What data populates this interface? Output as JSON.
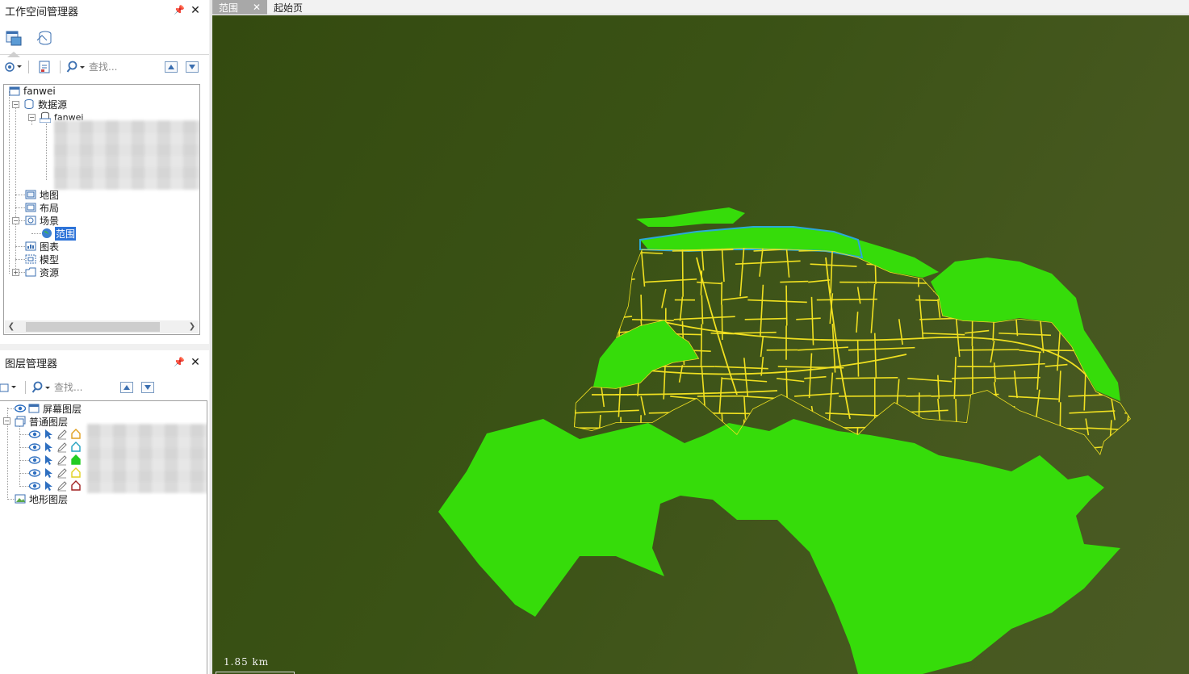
{
  "workspace_panel": {
    "title": "工作空间管理器",
    "search_placeholder": "查找...",
    "tree": {
      "root": "fanwei",
      "datasources": "数据源",
      "datasource_item": "fanwei",
      "maps": "地图",
      "layouts": "布局",
      "scenes": "场景",
      "scene_item": "范围",
      "charts": "图表",
      "models": "模型",
      "resources": "资源"
    }
  },
  "layer_panel": {
    "title": "图层管理器",
    "search_placeholder": "查找...",
    "screen_layers": "屏幕图层",
    "normal_layers": "普通图层",
    "terrain_layers": "地形图层",
    "layer_style_colors": [
      "#e0a020",
      "#20a0c0",
      "#22cc22",
      "#e0d020",
      "#a02020"
    ]
  },
  "map_tabs": [
    {
      "label": "范围",
      "active": true
    },
    {
      "label": "起始页",
      "active": false
    }
  ],
  "scene": {
    "scale_label": "1.85 km",
    "colors": {
      "background": "#3a5215",
      "green_area": "#36dc0a",
      "parcel_lines": "#f0e020",
      "river_outline": "#2aa8d8"
    }
  }
}
